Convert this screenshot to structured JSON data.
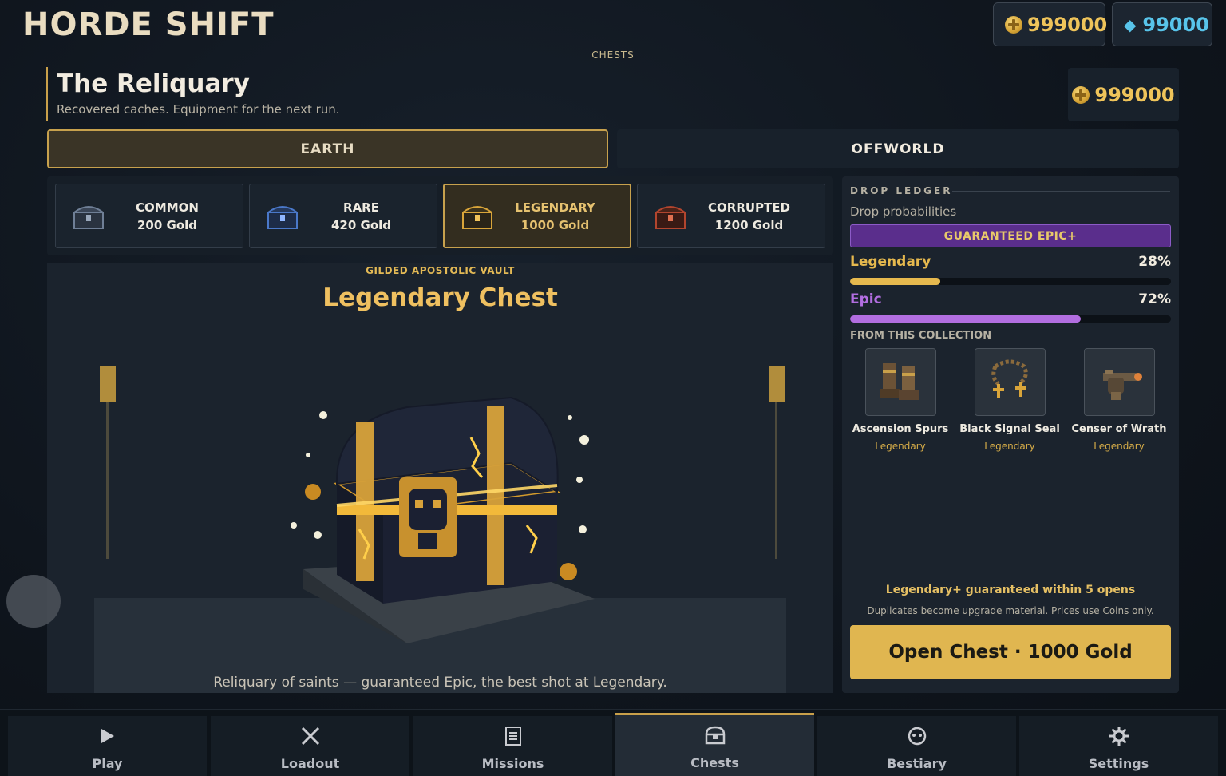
{
  "app": {
    "title": "HORDE SHIFT"
  },
  "currency": {
    "gold": "999000",
    "gems": "99000",
    "gold_icon": "coin-icon",
    "gem_icon": "diamond-icon"
  },
  "section_label": "CHESTS",
  "page": {
    "title": "The Reliquary",
    "subtitle": "Recovered caches. Equipment for the next run.",
    "balance": "999000"
  },
  "worlds": [
    {
      "label": "EARTH",
      "selected": true
    },
    {
      "label": "OFFWORLD",
      "selected": false
    }
  ],
  "tiers": [
    {
      "name": "COMMON",
      "price": "200 Gold",
      "icon": "common-chest-icon",
      "color": "#6f7f96"
    },
    {
      "name": "RARE",
      "price": "420 Gold",
      "icon": "rare-chest-icon",
      "color": "#4a78c9"
    },
    {
      "name": "LEGENDARY",
      "price": "1000 Gold",
      "icon": "legendary-chest-icon",
      "color": "#d9a53a",
      "selected": true
    },
    {
      "name": "CORRUPTED",
      "price": "1200 Gold",
      "icon": "corrupted-chest-icon",
      "color": "#b2452e"
    }
  ],
  "preview": {
    "subtitle": "GILDED APOSTOLIC VAULT",
    "title": "Legendary Chest",
    "description": "Reliquary of saints — guaranteed Epic, the best shot at Legendary."
  },
  "ledger": {
    "heading": "DROP LEDGER",
    "subtitle": "Drop probabilities",
    "guarantee": "GUARANTEED EPIC+",
    "odds": [
      {
        "rarity": "Legendary",
        "percent": "28%",
        "value": 0.28,
        "color": "#e6b94e"
      },
      {
        "rarity": "Epic",
        "percent": "72%",
        "value": 0.72,
        "color": "#b26ee0"
      }
    ],
    "collection_label": "FROM THIS COLLECTION",
    "items": [
      {
        "name": "Ascension Spurs",
        "rarity": "Legendary",
        "icon": "boots-icon"
      },
      {
        "name": "Black Signal Seal",
        "rarity": "Legendary",
        "icon": "rosary-icon"
      },
      {
        "name": "Censer of Wrath",
        "rarity": "Legendary",
        "icon": "censer-gun-icon"
      }
    ],
    "guarantee_note": "Legendary+ guaranteed within 5 opens",
    "duplicate_note": "Duplicates become upgrade material. Prices use Coins only.",
    "open_button": "Open Chest · 1000 Gold"
  },
  "nav": [
    {
      "label": "Play",
      "icon": "play-icon"
    },
    {
      "label": "Loadout",
      "icon": "crossed-swords-icon"
    },
    {
      "label": "Missions",
      "icon": "document-icon"
    },
    {
      "label": "Chests",
      "icon": "chest-icon",
      "active": true
    },
    {
      "label": "Bestiary",
      "icon": "creature-icon"
    },
    {
      "label": "Settings",
      "icon": "gear-icon"
    }
  ]
}
